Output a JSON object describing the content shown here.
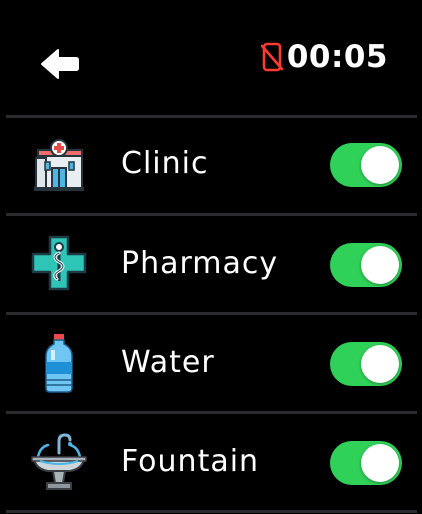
{
  "status_bar": {
    "time": "00:05",
    "back_icon": "back-arrow-icon",
    "phone_status_icon": "phone-disconnected-icon",
    "phone_status_color": "#ff3b30"
  },
  "rows": [
    {
      "label": "Clinic",
      "icon": "clinic-icon",
      "enabled": true
    },
    {
      "label": "Pharmacy",
      "icon": "pharmacy-icon",
      "enabled": true
    },
    {
      "label": "Water",
      "icon": "water-bottle-icon",
      "enabled": true
    },
    {
      "label": "Fountain",
      "icon": "fountain-icon",
      "enabled": true
    }
  ],
  "colors": {
    "toggle_on": "#30d158",
    "divider": "#2c2c2e",
    "background": "#000000"
  }
}
